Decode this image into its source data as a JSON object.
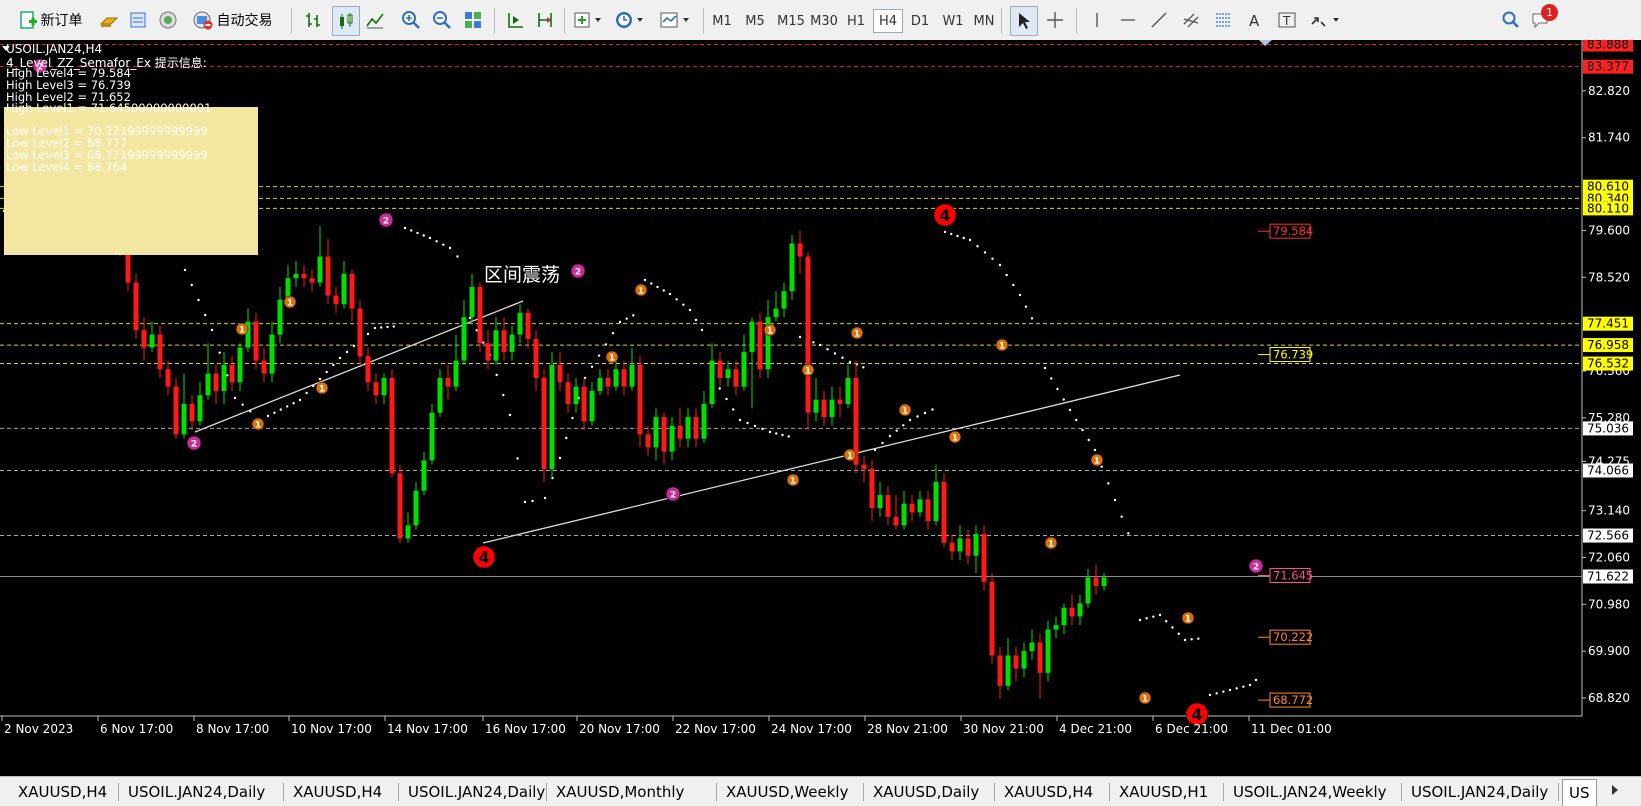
{
  "toolbar": {
    "new_order": "新订单",
    "auto_trade": "自动交易",
    "timeframes": [
      "M1",
      "M5",
      "M15",
      "M30",
      "H1",
      "H4",
      "D1",
      "W1",
      "MN"
    ],
    "active_timeframe": "H4",
    "notification_count": "1"
  },
  "chart": {
    "symbol_title": "USOIL.JAN24,H4",
    "indicator_title": "4_Level_ZZ_Semafor_Ex 提示信息:",
    "info_lines": [
      "High Level4 = 79.584",
      "High Level3 = 76.739",
      "High Level2 = 71.652",
      "High Level1 = 71.64500000000001",
      "Low Level1 = 70.22199999999999",
      "Low Level2 = 68.777",
      "Low Level3 = 68.77199999999999",
      "Low Level4 = 68.764"
    ],
    "annotation": "区间震荡",
    "price_ticks": [
      "83.900",
      "82.820",
      "81.740",
      "79.600",
      "78.520",
      "76.360",
      "75.280",
      "74.275",
      "73.140",
      "72.060",
      "70.980",
      "69.900",
      "68.820"
    ],
    "price_badges": [
      {
        "label": "83.377",
        "color": "#ff2020"
      },
      {
        "label": "83.888",
        "color": "#ff2020"
      },
      {
        "label": "80.610",
        "color": "#ffff00"
      },
      {
        "label": "80.340",
        "color": "#ffff00"
      },
      {
        "label": "80.110",
        "color": "#ffff00"
      },
      {
        "label": "77.451",
        "color": "#ffff00"
      },
      {
        "label": "76.958",
        "color": "#ffff00"
      },
      {
        "label": "76.532",
        "color": "#ffff00"
      },
      {
        "label": "75.036",
        "color": "#ffffff"
      },
      {
        "label": "74.066",
        "color": "#ffffff"
      },
      {
        "label": "72.566",
        "color": "#ffffff"
      },
      {
        "label": "71.622",
        "color": "#ffffff"
      }
    ],
    "level_labels": [
      {
        "label": "79.584",
        "color": "#ff3030"
      },
      {
        "label": "76.739",
        "color": "#ffff00"
      },
      {
        "label": "71.645",
        "color": "#ff5090"
      },
      {
        "label": "70.222",
        "color": "#ff8c1a"
      },
      {
        "label": "68.772",
        "color": "#ff8c1a"
      }
    ],
    "time_labels": [
      "2 Nov 2023",
      "6 Nov 17:00",
      "8 Nov 17:00",
      "10 Nov 17:00",
      "14 Nov 17:00",
      "16 Nov 17:00",
      "20 Nov 17:00",
      "22 Nov 17:00",
      "24 Nov 17:00",
      "28 Nov 21:00",
      "30 Nov 21:00",
      "4 Dec 21:00",
      "6 Dec 21:00",
      "11 Dec 01:00"
    ],
    "colors": {
      "bull": "#00e000",
      "bear": "#ff1a1a",
      "level_yellow": "#ffff00",
      "semafor1": "#e07000",
      "semafor2": "#cc2a9a",
      "semafor4": "#ff0000"
    }
  },
  "tabs": [
    "XAUUSD,H4",
    "USOIL.JAN24,Daily",
    "XAUUSD,H4",
    "USOIL.JAN24,Daily",
    "XAUUSD,Monthly",
    "XAUUSD,Weekly",
    "XAUUSD,Daily",
    "XAUUSD,H4",
    "XAUUSD,H1",
    "USOIL.JAN24,Weekly",
    "USOIL.JAN24,Daily",
    "US"
  ],
  "active_tab": "US"
}
